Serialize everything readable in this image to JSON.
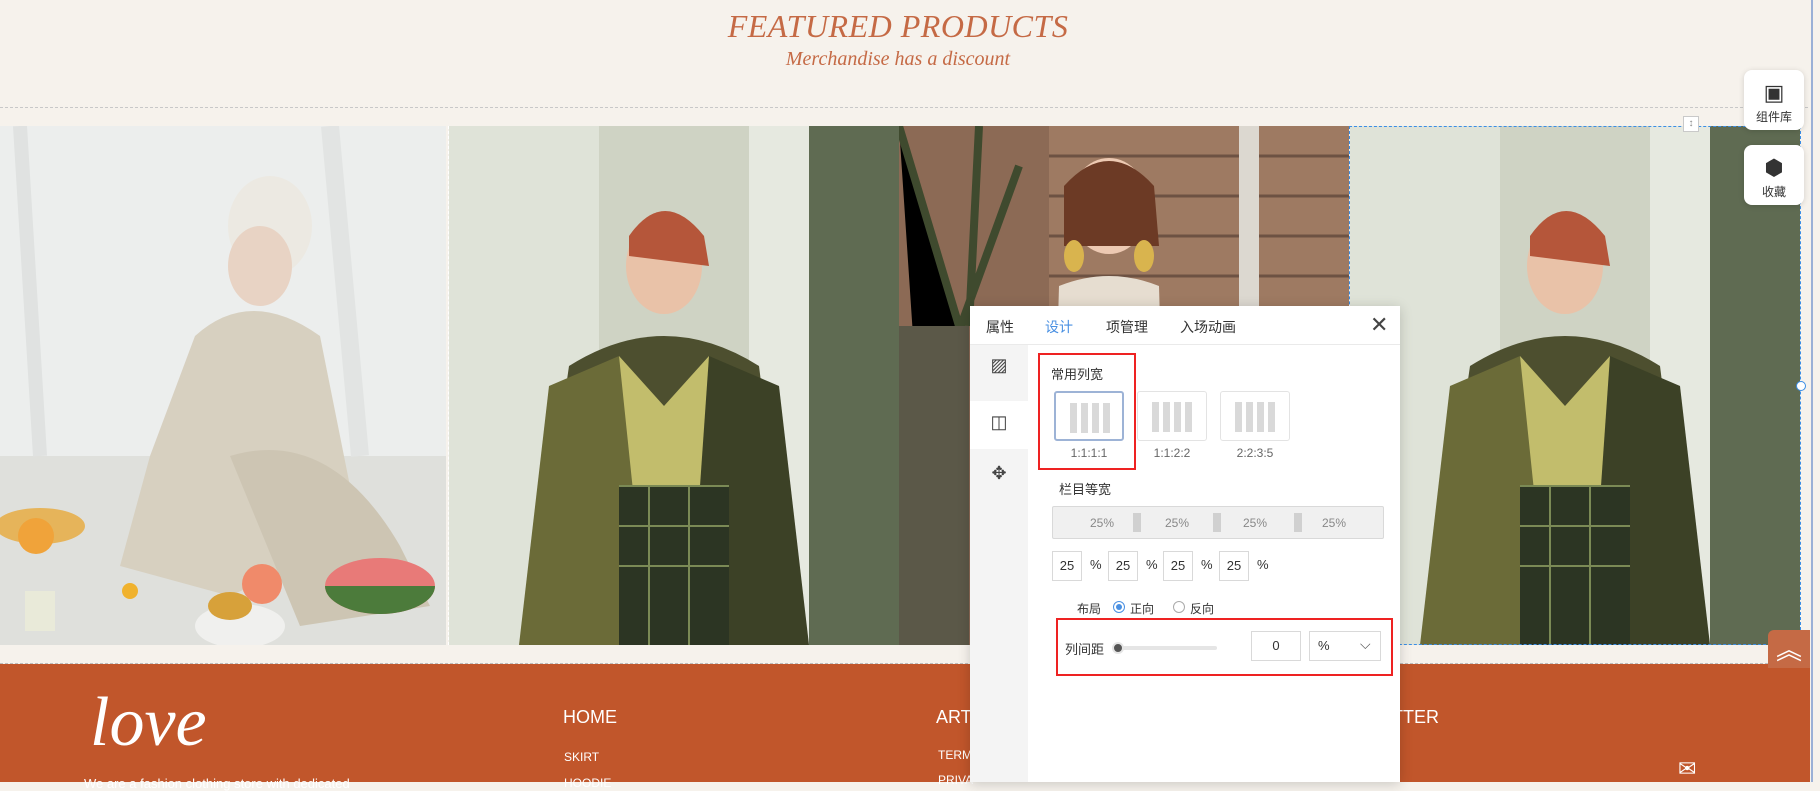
{
  "header": {
    "title": "FEATURED PRODUCTS",
    "subtitle": "Merchandise has a discount"
  },
  "tools": [
    {
      "icon": "component-library-icon",
      "label": "组件库"
    },
    {
      "icon": "favorites-icon",
      "label": "收藏"
    }
  ],
  "panel": {
    "tabs": [
      "属性",
      "设计",
      "项管理",
      "入场动画"
    ],
    "active_tab": "设计",
    "section_label": "常用列宽",
    "ratios": [
      "1:1:1:1",
      "1:1:2:2",
      "2:2:3:5"
    ],
    "equal_label": "栏目等宽",
    "segments": [
      "25%",
      "25%",
      "25%",
      "25%"
    ],
    "widths": [
      "25",
      "25",
      "25",
      "25"
    ],
    "pct": "%",
    "layout_label": "布局",
    "layout_options": [
      "正向",
      "反向"
    ],
    "layout_selected": "正向",
    "gap_label": "列间距",
    "gap_value": "0",
    "gap_unit": "%"
  },
  "footer": {
    "logo": "love",
    "tagline": "We are a fashion clothing store with dedicated",
    "col1_title": "HOME",
    "col1_links": [
      "SKIRT",
      "HOODIE"
    ],
    "col2_title": "ART",
    "col2_links": [
      "TERM",
      "PRIVA"
    ],
    "col3_title": "ETTER"
  },
  "colors": {
    "accent": "#c56a45",
    "footer_bg": "#c1562b",
    "selection": "#3a8ee6",
    "tab_active": "#4a90e2",
    "highlight": "#ee2222"
  }
}
